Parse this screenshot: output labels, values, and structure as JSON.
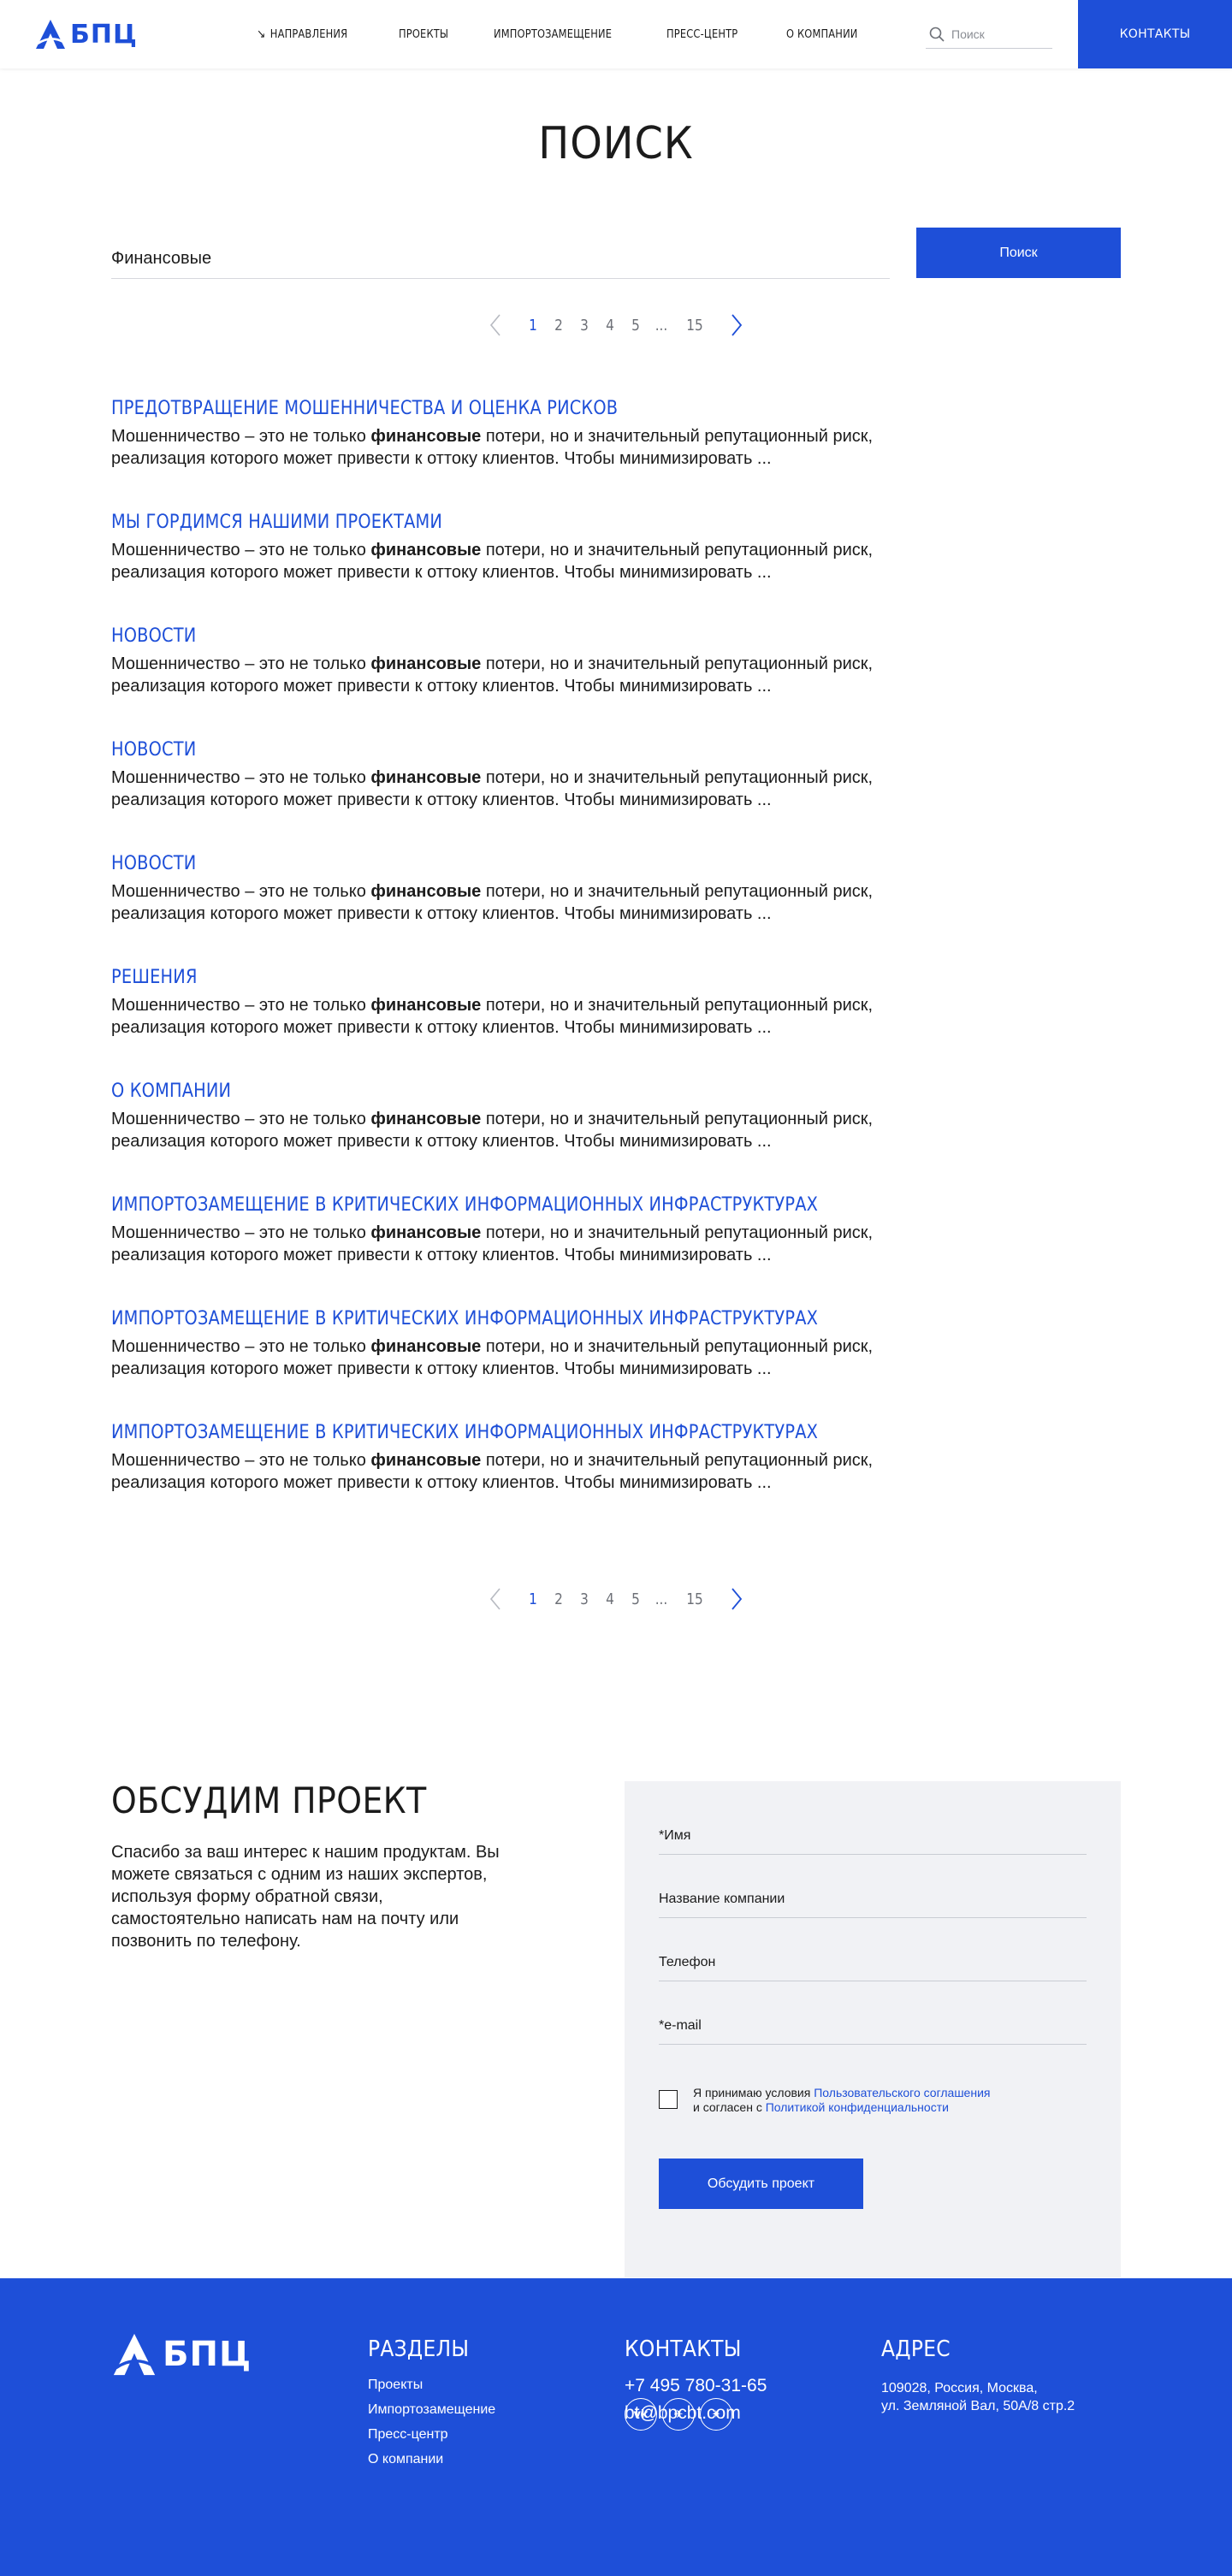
{
  "header": {
    "logo_text": "БПЦ",
    "nav": [
      {
        "label": "Направления",
        "icon": "arrow-down-right-icon"
      },
      {
        "label": "Проекты"
      },
      {
        "label": "Импортозамещение"
      },
      {
        "label": "Пресс-центр"
      },
      {
        "label": "О компании"
      }
    ],
    "search_placeholder": "Поиск",
    "contacts_label": "Контакты"
  },
  "page_title": "Поиск",
  "search": {
    "query": "Финансовые",
    "submit_label": "Поиск"
  },
  "pagination": {
    "pages": [
      "1",
      "2",
      "3",
      "4",
      "5",
      "...",
      "15"
    ],
    "current": "1"
  },
  "results": [
    {
      "title": "Предотвращение мошенничества и оценка рисков",
      "pre": "Мошенничество – это не только ",
      "highlight": "финансовые",
      "post": " потери, но и значительный репутационный риск, реализация которого может привести к оттоку клиентов. Чтобы минимизировать ..."
    },
    {
      "title": "Мы гордимся нашими проектами",
      "pre": "Мошенничество – это не только ",
      "highlight": "финансовые",
      "post": " потери, но и значительный репутационный риск, реализация которого может привести к оттоку клиентов. Чтобы минимизировать ..."
    },
    {
      "title": "Новости",
      "pre": "Мошенничество – это не только ",
      "highlight": "финансовые",
      "post": " потери, но и значительный репутационный риск, реализация которого может привести к оттоку клиентов. Чтобы минимизировать ..."
    },
    {
      "title": "Новости",
      "pre": "Мошенничество – это не только ",
      "highlight": "финансовые",
      "post": " потери, но и значительный репутационный риск, реализация которого может привести к оттоку клиентов. Чтобы минимизировать ..."
    },
    {
      "title": "Новости",
      "pre": "Мошенничество – это не только ",
      "highlight": "финансовые",
      "post": " потери, но и значительный репутационный риск, реализация которого может привести к оттоку клиентов. Чтобы минимизировать ..."
    },
    {
      "title": "Решения",
      "pre": "Мошенничество – это не только ",
      "highlight": "финансовые",
      "post": " потери, но и значительный репутационный риск, реализация которого может привести к оттоку клиентов. Чтобы минимизировать ..."
    },
    {
      "title": "О компании",
      "pre": "Мошенничество – это не только ",
      "highlight": "финансовые",
      "post": " потери, но и значительный репутационный риск, реализация которого может привести к оттоку клиентов. Чтобы минимизировать ..."
    },
    {
      "title": "Импортозамещение в критических информационных инфраструктурах",
      "pre": "Мошенничество – это не только ",
      "highlight": "финансовые",
      "post": " потери, но и значительный репутационный риск, реализация которого может привести к оттоку клиентов. Чтобы минимизировать ..."
    },
    {
      "title": "Импортозамещение в критических информационных инфраструктурах",
      "pre": "Мошенничество – это не только ",
      "highlight": "финансовые",
      "post": " потери, но и значительный репутационный риск, реализация которого может привести к оттоку клиентов. Чтобы минимизировать ..."
    },
    {
      "title": "Импортозамещение в критических информационных инфраструктурах",
      "pre": "Мошенничество – это не только ",
      "highlight": "финансовые",
      "post": " потери, но и значительный репутационный риск, реализация которого может привести к оттоку клиентов. Чтобы минимизировать ..."
    }
  ],
  "discuss": {
    "title": "Обсудим проект",
    "text": "Спасибо за ваш интерес к нашим продуктам. Вы можете связаться с одним из наших экспертов, используя форму обратной связи, самостоятельно написать нам на почту или позвонить по телефону.",
    "fields": [
      {
        "placeholder": "*Имя"
      },
      {
        "placeholder": "Название компании"
      },
      {
        "placeholder": "Телефон"
      },
      {
        "placeholder": "*e-mail"
      }
    ],
    "consent_prefix": "Я принимаю условия ",
    "consent_link1": "Пользовательского соглашения",
    "consent_middle": "и согласен с ",
    "consent_link2": "Политикой конфиденциальности",
    "submit_label": "Обсудить проект"
  },
  "footer": {
    "logo_text": "БПЦ",
    "sections_title": "Разделы",
    "sections": [
      "Проекты",
      "Импортозамещение",
      "Пресс-центр",
      "О компании"
    ],
    "contacts_title": "Контакты",
    "phone": "+7 495 780-31-65",
    "email": "bt@bpcbt.com",
    "address_title": "Адрес",
    "address_line1": "109028, Россия, Москва,",
    "address_line2": "ул. Земляной Вал, 50А/8 стр.2",
    "socials": [
      {
        "icon": "vk-icon",
        "glyph": "vk"
      },
      {
        "icon": "telegram-icon",
        "glyph": "✈"
      },
      {
        "icon": "star-icon",
        "glyph": "✦"
      }
    ]
  },
  "colors": {
    "accent": "#1e4fd8",
    "panel": "#f1f2f5",
    "text": "#1b1b1b"
  }
}
